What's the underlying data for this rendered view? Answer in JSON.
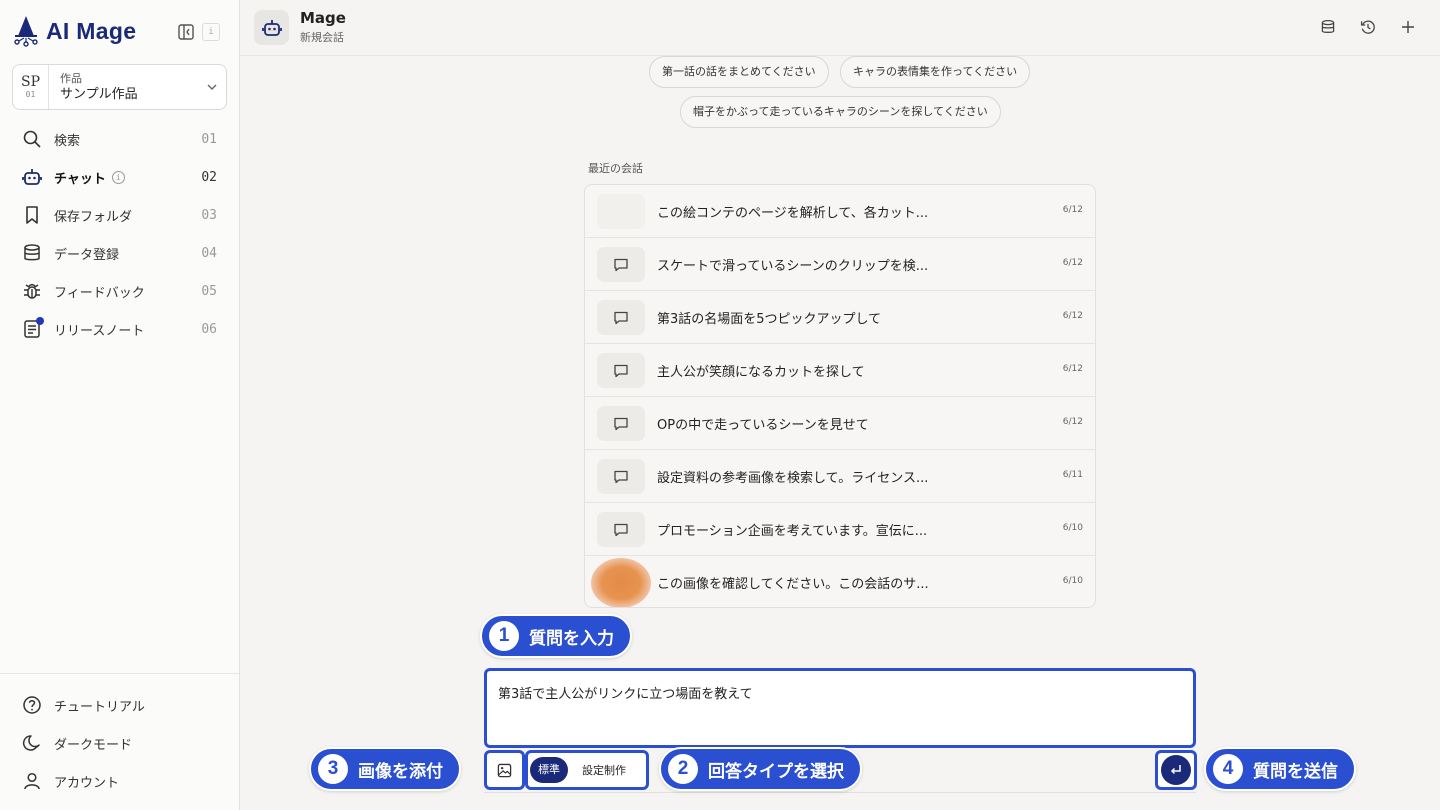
{
  "brand": {
    "name": "AI Mage"
  },
  "sidebar": {
    "info_label": "i",
    "project": {
      "code": "SP",
      "code_num": "01",
      "label": "作品",
      "name": "サンプル作品"
    },
    "nav": [
      {
        "label": "検索",
        "num": "01"
      },
      {
        "label": "チャット",
        "num": "02"
      },
      {
        "label": "保存フォルダ",
        "num": "03"
      },
      {
        "label": "データ登録",
        "num": "04"
      },
      {
        "label": "フィードバック",
        "num": "05"
      },
      {
        "label": "リリースノート",
        "num": "06"
      }
    ],
    "bottom": [
      {
        "label": "チュートリアル"
      },
      {
        "label": "ダークモード"
      },
      {
        "label": "アカウント"
      }
    ]
  },
  "header": {
    "title": "Mage",
    "subtitle": "新規会話"
  },
  "suggestions": [
    "第一話の話をまとめてください",
    "キャラの表情集を作ってください",
    "帽子をかぶって走っているキャラのシーンを探してください"
  ],
  "recent": {
    "title": "最近の会話",
    "items": [
      {
        "text": "この絵コンテのページを解析して、各カット...",
        "date": "6/12"
      },
      {
        "text": "スケートで滑っているシーンのクリップを検...",
        "date": "6/12"
      },
      {
        "text": "第3話の名場面を5つピックアップして",
        "date": "6/12"
      },
      {
        "text": "主人公が笑顔になるカットを探して",
        "date": "6/12"
      },
      {
        "text": "OPの中で走っているシーンを見せて",
        "date": "6/12"
      },
      {
        "text": "設定資料の参考画像を検索して。ライセンス...",
        "date": "6/11"
      },
      {
        "text": "プロモーション企画を考えています。宣伝に...",
        "date": "6/10"
      },
      {
        "text": "この画像を確認してください。この会話のサ...",
        "date": "6/10"
      }
    ]
  },
  "input": {
    "value": "第3話で主人公がリンクに立つ場面を教えて",
    "type_selected": "標準",
    "type_other": "設定制作"
  },
  "callouts": [
    {
      "num": "1",
      "text": "質問を入力"
    },
    {
      "num": "2",
      "text": "回答タイプを選択"
    },
    {
      "num": "3",
      "text": "画像を添付"
    },
    {
      "num": "4",
      "text": "質問を送信"
    }
  ],
  "colors": {
    "brand": "#1b2a78",
    "callout": "#2a4fd0",
    "background": "#f5f4f2"
  }
}
